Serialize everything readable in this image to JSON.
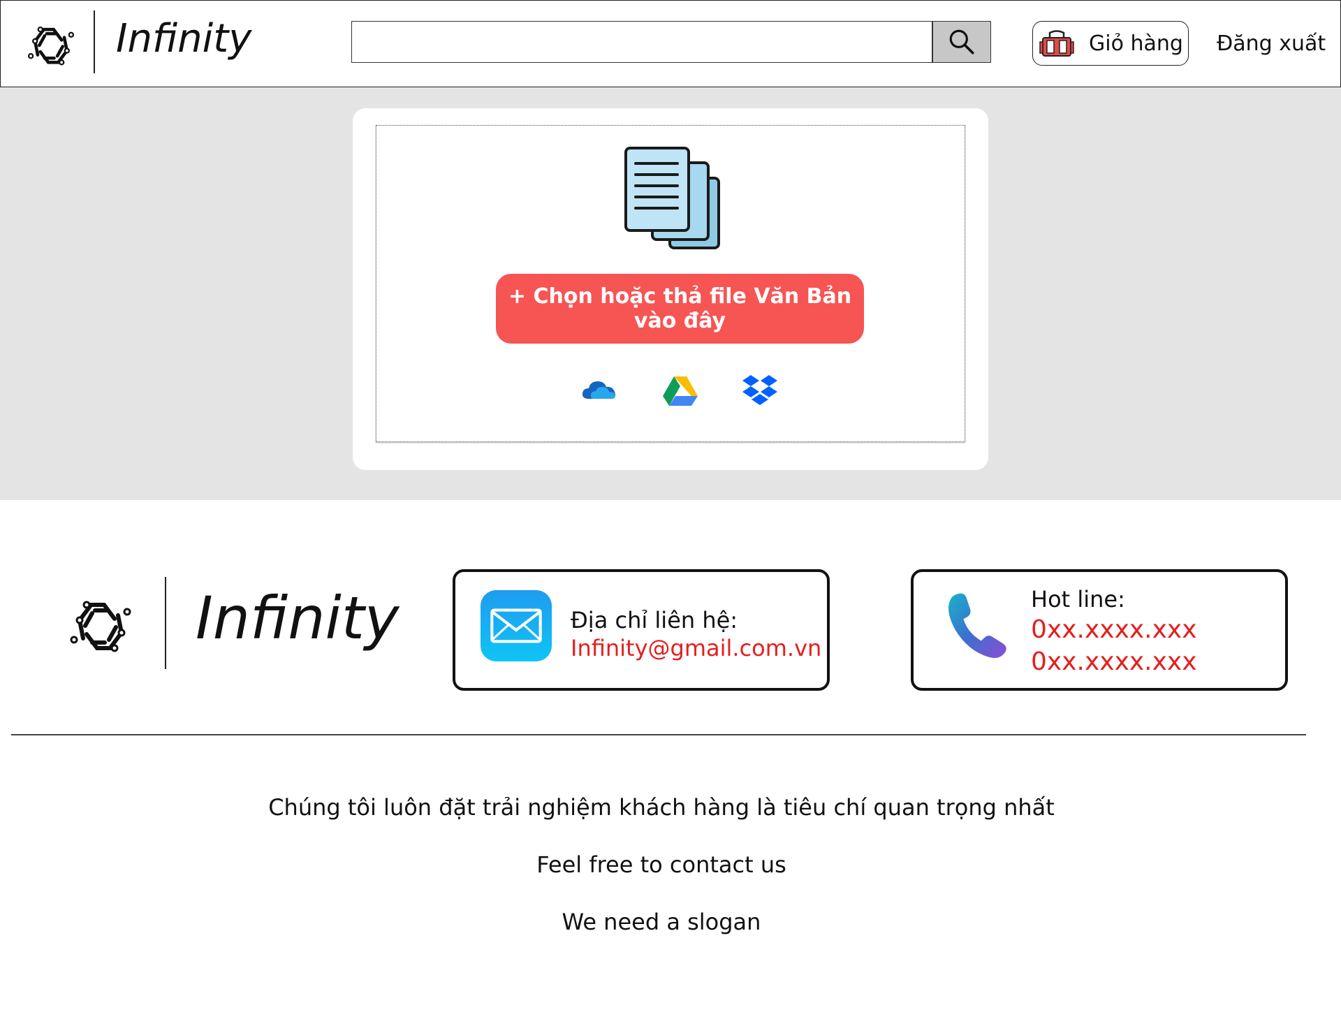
{
  "header": {
    "brand": "Infinity",
    "search": {
      "value": "",
      "placeholder": ""
    },
    "cart_label": "Giỏ hàng",
    "logout_label": "Đăng xuất"
  },
  "upload": {
    "button_label": "+ Chọn hoặc thả file Văn Bản vào đây",
    "providers": [
      "onedrive-icon",
      "google-drive-icon",
      "dropbox-icon"
    ]
  },
  "footer": {
    "brand": "Infinity",
    "email": {
      "label": "Địa chỉ liên hệ:",
      "value": "Infinity@gmail.com.vn"
    },
    "hotline": {
      "label": "Hot line:",
      "numbers": [
        "0xx.xxxx.xxx",
        "0xx.xxxx.xxx"
      ]
    },
    "taglines": [
      "Chúng tôi luôn đặt trải nghiệm khách hàng là tiêu chí quan trọng nhất",
      "Feel free to contact us",
      "We need a slogan"
    ]
  },
  "colors": {
    "accent_button": "#f75454",
    "contact_value": "#e51e1e",
    "page_band": "#e4e4e4",
    "search_button": "#c7c7c7"
  }
}
